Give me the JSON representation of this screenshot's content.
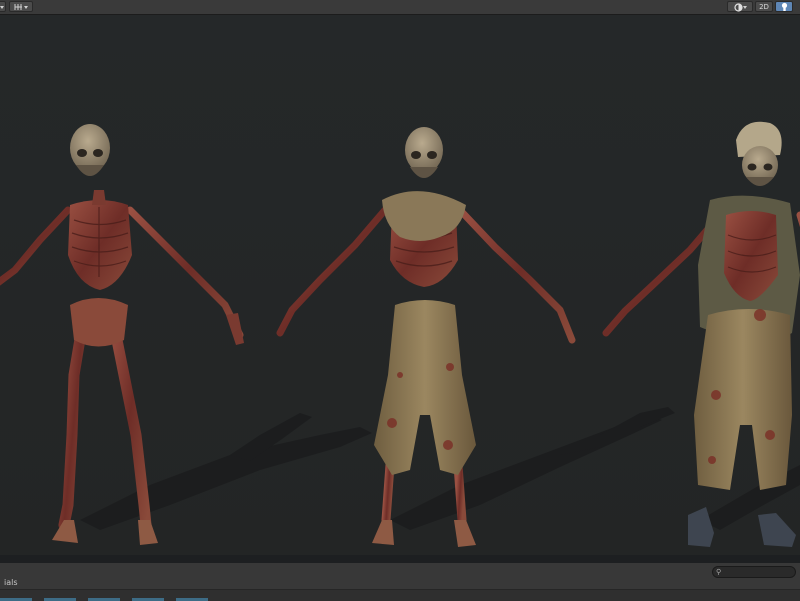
{
  "toolbar": {
    "left_icons": [
      "dropdown-arrow-icon",
      "gizmo-grid-icon"
    ],
    "right_buttons": {
      "shading_icon": "shading-mode-icon",
      "mode_2d_label": "2D",
      "light_icon": "scene-lighting-icon"
    }
  },
  "viewport": {
    "characters": [
      "skeleton-bare",
      "skeleton-with-pants",
      "skeleton-with-vest-and-hat"
    ]
  },
  "bottom_panel": {
    "tab_label": "ials",
    "search_placeholder": ""
  },
  "colors": {
    "toolbar_bg": "#3a3a3a",
    "viewport_bg": "#252829",
    "active_button": "#5e86b5",
    "bone": "#8a4438",
    "cloth": "#8e7a56"
  }
}
